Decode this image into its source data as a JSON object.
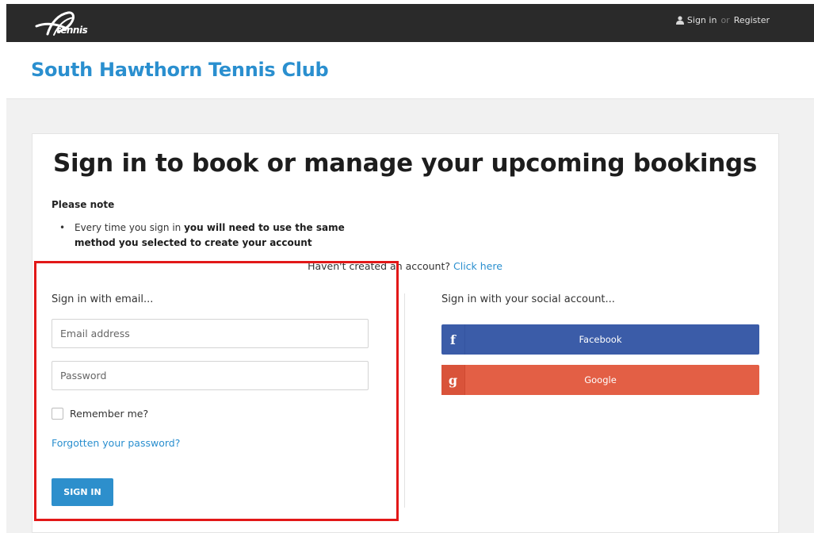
{
  "nav": {
    "logo_text": "tennis",
    "sign_in": "Sign in",
    "or": "or",
    "register": "Register"
  },
  "club": {
    "title": "South Hawthorn Tennis Club"
  },
  "page": {
    "heading": "Sign in to book or manage your upcoming bookings",
    "note_title": "Please note",
    "note_prefix": "Every time you sign in ",
    "note_bold": "you will need to use the same method you selected to create your account",
    "create_text": "Haven't created an account? ",
    "create_link": "Click here"
  },
  "email_form": {
    "section_label": "Sign in with email...",
    "email_placeholder": "Email address",
    "password_placeholder": "Password",
    "remember_label": "Remember me?",
    "forgot_link": "Forgotten your password?",
    "submit_label": "SIGN IN"
  },
  "social": {
    "section_label": "Sign in with your social account...",
    "facebook_label": "Facebook",
    "facebook_icon": "f",
    "google_label": "Google",
    "google_icon": "g"
  },
  "colors": {
    "brand_blue": "#2a8fcf",
    "facebook": "#3b5ca8",
    "google": "#e35f45",
    "highlight": "#e21818",
    "topbar": "#2a2a2a"
  }
}
